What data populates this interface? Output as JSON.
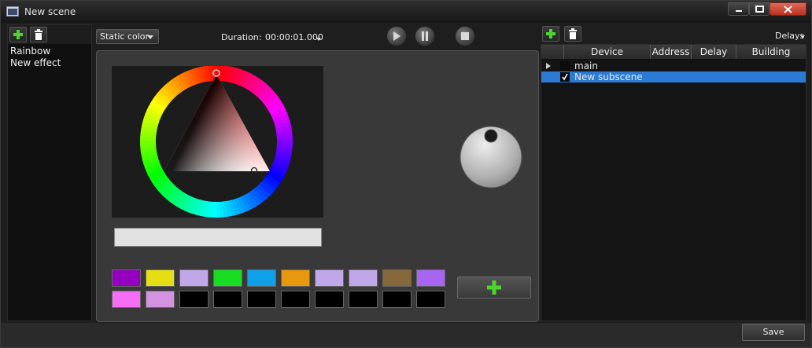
{
  "window": {
    "title": "New scene"
  },
  "effects": {
    "items": [
      "Rainbow",
      "New effect"
    ]
  },
  "toolbar": {
    "mode_select": "Static color",
    "duration_label": "Duration:",
    "duration_value": "00:00:01.000"
  },
  "color_editor": {
    "hex_value": "",
    "presets": [
      "#9500c0",
      "#e4df14",
      "#c0a8e8",
      "#17de23",
      "#10a0e8",
      "#e8980f",
      "#c0a8e8",
      "#c0a8e8",
      "#86683a",
      "#a865f4",
      "#f56ef5",
      "#d493e0",
      "#000000",
      "#000000",
      "#000000",
      "#000000",
      "#000000",
      "#000000",
      "#000000",
      "#000000"
    ]
  },
  "subscenes": {
    "delays_menu": "Delays",
    "columns": [
      "Device",
      "Address",
      "Delay",
      "Building"
    ],
    "rows": [
      {
        "name": "main",
        "checked": false,
        "selected": false
      },
      {
        "name": "New subscene",
        "checked": true,
        "selected": true
      }
    ]
  },
  "footer": {
    "save_label": "Save"
  },
  "colors": {
    "accent": "#2b7bd6",
    "add_green": "#4cd52b"
  }
}
